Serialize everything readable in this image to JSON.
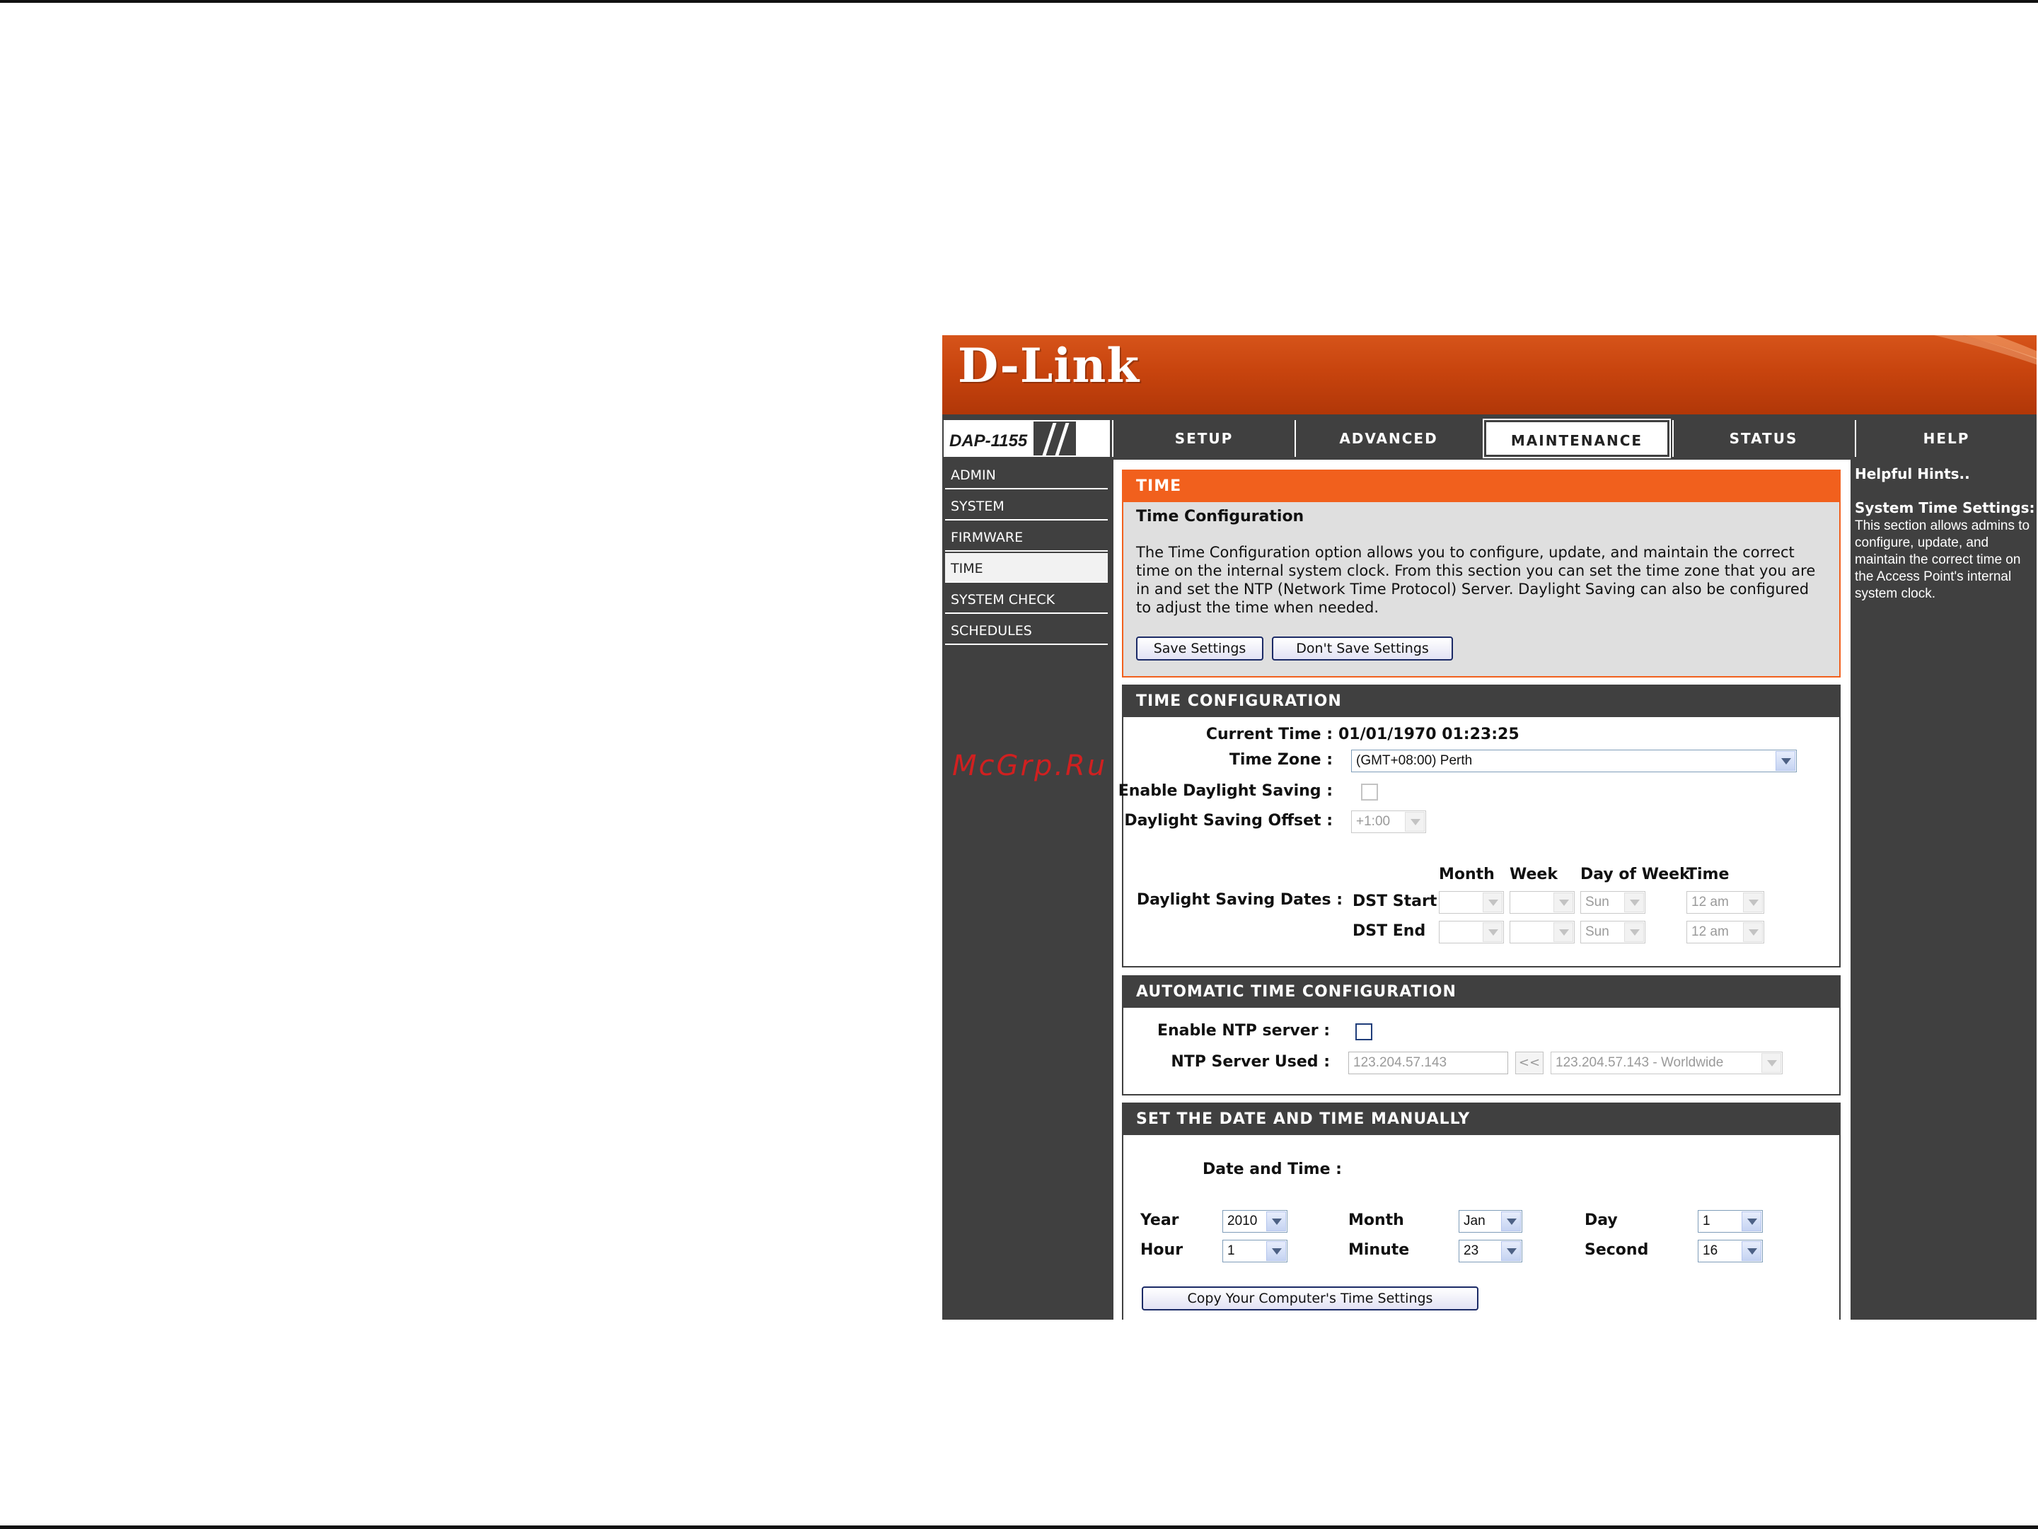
{
  "brand": {
    "logo": "D-Link",
    "model": "DAP-1155"
  },
  "nav": {
    "tabs": [
      {
        "label": "SETUP"
      },
      {
        "label": "ADVANCED"
      },
      {
        "label": "MAINTENANCE"
      },
      {
        "label": "STATUS"
      },
      {
        "label": "HELP"
      }
    ],
    "active": "MAINTENANCE"
  },
  "sidebar": {
    "items": [
      {
        "label": "ADMIN"
      },
      {
        "label": "SYSTEM"
      },
      {
        "label": "FIRMWARE"
      },
      {
        "label": "TIME"
      },
      {
        "label": "SYSTEM CHECK"
      },
      {
        "label": "SCHEDULES"
      }
    ],
    "active": "TIME",
    "watermark": "McGrp.Ru"
  },
  "intro": {
    "header": "TIME",
    "subtitle": "Time Configuration",
    "description": "The Time Configuration option allows you to configure, update, and maintain the correct time on the internal system clock. From this section you can set the time zone that you are in and set the NTP (Network Time Protocol) Server. Daylight Saving can also be configured to adjust the time when needed.",
    "save_label": "Save Settings",
    "dont_save_label": "Don't Save Settings"
  },
  "time_config": {
    "header": "TIME CONFIGURATION",
    "current_time_label": "Current Time :",
    "current_time_value": "01/01/1970 01:23:25",
    "time_zone_label": "Time Zone :",
    "time_zone_value": "(GMT+08:00) Perth",
    "daylight_saving_label": "Enable Daylight Saving :",
    "offset_label": "Daylight Saving Offset :",
    "offset_value": "+1:00",
    "dates_label": "Daylight Saving Dates :",
    "col_month": "Month",
    "col_week": "Week",
    "col_day": "Day of Week",
    "col_time": "Time",
    "dst_start_label": "DST Start",
    "dst_end_label": "DST End",
    "dst_start_day": "Sun",
    "dst_start_time": "12 am",
    "dst_end_day": "Sun",
    "dst_end_time": "12 am"
  },
  "auto_config": {
    "header": "AUTOMATIC TIME CONFIGURATION",
    "ntp_enable_label": "Enable NTP server :",
    "ntp_used_label": "NTP Server Used :",
    "ntp_input_value": "123.204.57.143",
    "copy_arrow_label": "<<",
    "ntp_select_value": "123.204.57.143 - Worldwide"
  },
  "manual": {
    "header": "SET THE DATE AND TIME MANUALLY",
    "date_time_label": "Date and Time :",
    "year_label": "Year",
    "year_value": "2010",
    "month_label": "Month",
    "month_value": "Jan",
    "day_label": "Day",
    "day_value": "1",
    "hour_label": "Hour",
    "hour_value": "1",
    "minute_label": "Minute",
    "minute_value": "23",
    "second_label": "Second",
    "second_value": "16",
    "copy_button_label": "Copy Your Computer's Time Settings"
  },
  "help": {
    "title": "Helpful Hints..",
    "heading": "System Time Settings:",
    "text": "This section allows admins to configure, update, and maintain the correct time on the Access Point's internal system clock."
  },
  "colors": {
    "brand_orange": "#f1601d",
    "nav_dark": "#404040"
  }
}
